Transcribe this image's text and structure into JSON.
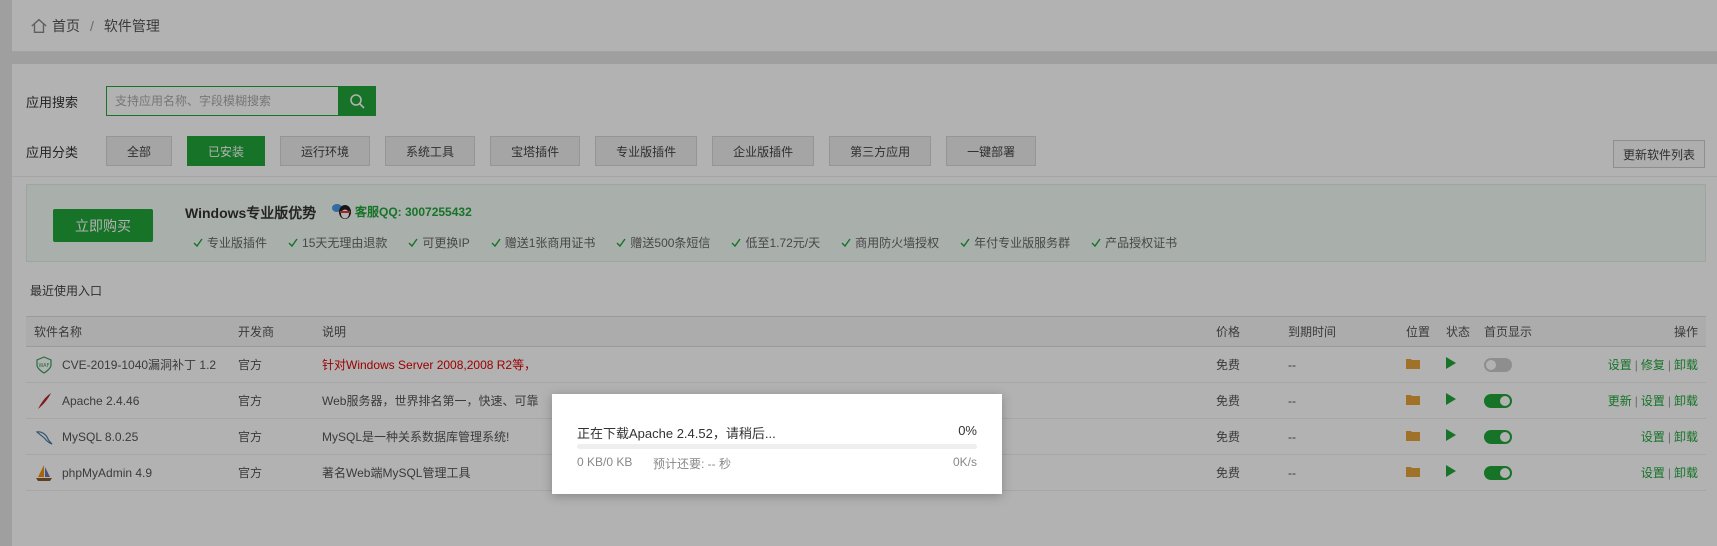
{
  "breadcrumb": {
    "home": "首页",
    "sep": "/",
    "current": "软件管理"
  },
  "search": {
    "label": "应用搜索",
    "placeholder": "支持应用名称、字段模糊搜索",
    "value": ""
  },
  "categories": {
    "label": "应用分类",
    "items": [
      "全部",
      "已安装",
      "运行环境",
      "系统工具",
      "宝塔插件",
      "专业版插件",
      "企业版插件",
      "第三方应用",
      "一键部署"
    ],
    "active": "已安装"
  },
  "update_button": "更新软件列表",
  "promo": {
    "buy_button": "立即购买",
    "title": "Windows专业版优势",
    "qq": "客服QQ: 3007255432",
    "features": [
      "专业版插件",
      "15天无理由退款",
      "可更换IP",
      "赠送1张商用证书",
      "赠送500条短信",
      "低至1.72元/天",
      "商用防火墙授权",
      "年付专业版服务群",
      "产品授权证书"
    ]
  },
  "recent_label": "最近使用入口",
  "table": {
    "headers": [
      "软件名称",
      "开发商",
      "说明",
      "价格",
      "到期时间",
      "位置",
      "状态",
      "首页显示",
      "操作"
    ],
    "rows": [
      {
        "name": "CVE-2019-1040漏洞补丁 1.2",
        "dev": "官方",
        "desc": "针对Windows Server 2008,2008 R2等，",
        "price": "免费",
        "expire": "--",
        "ops": [
          "设置",
          "修复",
          "卸载"
        ],
        "home_show": false,
        "icon": "waf-icon"
      },
      {
        "name": "Apache 2.4.46",
        "dev": "官方",
        "desc": "Web服务器，世界排名第一，快速、可靠",
        "price": "免费",
        "expire": "--",
        "ops": [
          "更新",
          "设置",
          "卸载"
        ],
        "home_show": true,
        "icon": "apache-feather-icon"
      },
      {
        "name": "MySQL 8.0.25",
        "dev": "官方",
        "desc": "MySQL是一种关系数据库管理系统!",
        "price": "免费",
        "expire": "--",
        "ops": [
          "设置",
          "卸载"
        ],
        "home_show": true,
        "icon": "mysql-dolphin-icon"
      },
      {
        "name": "phpMyAdmin 4.9",
        "dev": "官方",
        "desc": "著名Web端MySQL管理工具",
        "price": "免费",
        "expire": "--",
        "ops": [
          "设置",
          "卸载"
        ],
        "home_show": true,
        "icon": "phpmyadmin-sail-icon"
      }
    ]
  },
  "download_dialog": {
    "message": "正在下载Apache 2.4.52，请稍后...",
    "percent": "0%",
    "progress": 0,
    "size": "0 KB/0 KB",
    "remaining": "预计还要: -- 秒",
    "speed": "0K/s"
  },
  "colors": {
    "accent": "#20a53a",
    "warning_text": "#e00000",
    "folder": "#e6a23c"
  }
}
